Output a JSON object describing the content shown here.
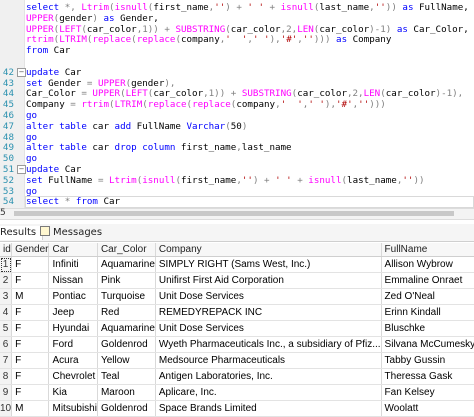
{
  "editor": {
    "lines": [
      {
        "n": "",
        "tokens": [
          [
            "kw",
            "select "
          ],
          [
            "op",
            "*, "
          ],
          [
            "fn",
            "Ltrim"
          ],
          [
            "op",
            "("
          ],
          [
            "fn",
            "isnull"
          ],
          [
            "op",
            "("
          ],
          [
            "pl",
            "first_name"
          ],
          [
            "op",
            ","
          ],
          [
            "str",
            "''"
          ],
          [
            "op",
            ") + "
          ],
          [
            "str",
            "' '"
          ],
          [
            "op",
            " + "
          ],
          [
            "fn",
            "isnull"
          ],
          [
            "op",
            "("
          ],
          [
            "pl",
            "last_name"
          ],
          [
            "op",
            ","
          ],
          [
            "str",
            "''"
          ],
          [
            "op",
            "))"
          ],
          [
            "kw",
            " as "
          ],
          [
            "pl",
            "FullName,"
          ]
        ]
      },
      {
        "n": "",
        "tokens": [
          [
            "fn",
            "UPPER"
          ],
          [
            "op",
            "("
          ],
          [
            "pl",
            "gender"
          ],
          [
            "op",
            ")"
          ],
          [
            "kw",
            " as "
          ],
          [
            "pl",
            "Gender,"
          ]
        ]
      },
      {
        "n": "",
        "tokens": [
          [
            "fn",
            "UPPER"
          ],
          [
            "op",
            "("
          ],
          [
            "fn",
            "LEFT"
          ],
          [
            "op",
            "("
          ],
          [
            "pl",
            "car_color"
          ],
          [
            "op",
            ",1)) + "
          ],
          [
            "fn",
            "SUBSTRING"
          ],
          [
            "op",
            "("
          ],
          [
            "pl",
            "car_color"
          ],
          [
            "op",
            ",2,"
          ],
          [
            "fn",
            "LEN"
          ],
          [
            "op",
            "("
          ],
          [
            "pl",
            "car_color"
          ],
          [
            "op",
            ")-1)"
          ],
          [
            "kw",
            " as "
          ],
          [
            "pl",
            "Car_Color,"
          ]
        ]
      },
      {
        "n": "",
        "tokens": [
          [
            "fn",
            "rtrim"
          ],
          [
            "op",
            "("
          ],
          [
            "fn",
            "LTRIM"
          ],
          [
            "op",
            "("
          ],
          [
            "fn",
            "replace"
          ],
          [
            "op",
            "("
          ],
          [
            "fn",
            "replace"
          ],
          [
            "op",
            "("
          ],
          [
            "pl",
            "company"
          ],
          [
            "op",
            ","
          ],
          [
            "str",
            "'  '"
          ],
          [
            "op",
            ","
          ],
          [
            "str",
            "' '"
          ],
          [
            "op",
            "),"
          ],
          [
            "str",
            "'#'"
          ],
          [
            "op",
            ","
          ],
          [
            "str",
            "''"
          ],
          [
            "op",
            ")))"
          ],
          [
            "kw",
            " as "
          ],
          [
            "pl",
            "Company"
          ]
        ]
      },
      {
        "n": "",
        "tokens": [
          [
            "kw",
            "from "
          ],
          [
            "pl",
            "Car"
          ]
        ]
      },
      {
        "n": "",
        "tokens": []
      },
      {
        "n": "42",
        "tokens": [
          [
            "kw",
            "update "
          ],
          [
            "pl",
            "Car"
          ]
        ]
      },
      {
        "n": "43",
        "tokens": [
          [
            "kw",
            "set "
          ],
          [
            "pl",
            "Gender "
          ],
          [
            "op",
            "= "
          ],
          [
            "fn",
            "UPPER"
          ],
          [
            "op",
            "("
          ],
          [
            "pl",
            "gender"
          ],
          [
            "op",
            "),"
          ]
        ]
      },
      {
        "n": "44",
        "tokens": [
          [
            "pl",
            "Car_Color "
          ],
          [
            "op",
            "= "
          ],
          [
            "fn",
            "UPPER"
          ],
          [
            "op",
            "("
          ],
          [
            "fn",
            "LEFT"
          ],
          [
            "op",
            "("
          ],
          [
            "pl",
            "car_color"
          ],
          [
            "op",
            ",1)) + "
          ],
          [
            "fn",
            "SUBSTRING"
          ],
          [
            "op",
            "("
          ],
          [
            "pl",
            "car_color"
          ],
          [
            "op",
            ",2,"
          ],
          [
            "fn",
            "LEN"
          ],
          [
            "op",
            "("
          ],
          [
            "pl",
            "car_color"
          ],
          [
            "op",
            ")-1),"
          ]
        ]
      },
      {
        "n": "45",
        "tokens": [
          [
            "pl",
            "Company "
          ],
          [
            "op",
            "= "
          ],
          [
            "fn",
            "rtrim"
          ],
          [
            "op",
            "("
          ],
          [
            "fn",
            "LTRIM"
          ],
          [
            "op",
            "("
          ],
          [
            "fn",
            "replace"
          ],
          [
            "op",
            "("
          ],
          [
            "fn",
            "replace"
          ],
          [
            "op",
            "("
          ],
          [
            "pl",
            "company"
          ],
          [
            "op",
            ","
          ],
          [
            "str",
            "'  '"
          ],
          [
            "op",
            ","
          ],
          [
            "str",
            "' '"
          ],
          [
            "op",
            "),"
          ],
          [
            "str",
            "'#'"
          ],
          [
            "op",
            ","
          ],
          [
            "str",
            "''"
          ],
          [
            "op",
            ")))"
          ]
        ]
      },
      {
        "n": "46",
        "tokens": [
          [
            "kw",
            "go"
          ]
        ]
      },
      {
        "n": "47",
        "tokens": [
          [
            "kw",
            "alter table "
          ],
          [
            "pl",
            "car "
          ],
          [
            "kw",
            "add "
          ],
          [
            "pl",
            "FullName "
          ],
          [
            "kw",
            "Varchar"
          ],
          [
            "op",
            "("
          ],
          [
            "pl",
            "50"
          ],
          [
            "op",
            ")"
          ]
        ]
      },
      {
        "n": "48",
        "tokens": [
          [
            "kw",
            "go"
          ]
        ]
      },
      {
        "n": "49",
        "tokens": [
          [
            "kw",
            "alter table "
          ],
          [
            "pl",
            "car "
          ],
          [
            "kw",
            "drop column "
          ],
          [
            "pl",
            "first_name"
          ],
          [
            "op",
            ","
          ],
          [
            "pl",
            "last_name"
          ]
        ]
      },
      {
        "n": "50",
        "tokens": [
          [
            "kw",
            "go"
          ]
        ]
      },
      {
        "n": "51",
        "tokens": [
          [
            "kw",
            "update "
          ],
          [
            "pl",
            "Car"
          ]
        ]
      },
      {
        "n": "52",
        "tokens": [
          [
            "kw",
            "set "
          ],
          [
            "pl",
            "FullName "
          ],
          [
            "op",
            "= "
          ],
          [
            "fn",
            "Ltrim"
          ],
          [
            "op",
            "("
          ],
          [
            "fn",
            "isnull"
          ],
          [
            "op",
            "("
          ],
          [
            "pl",
            "first_name"
          ],
          [
            "op",
            ","
          ],
          [
            "str",
            "''"
          ],
          [
            "op",
            ") + "
          ],
          [
            "str",
            "' '"
          ],
          [
            "op",
            " + "
          ],
          [
            "fn",
            "isnull"
          ],
          [
            "op",
            "("
          ],
          [
            "pl",
            "last_name"
          ],
          [
            "op",
            ","
          ],
          [
            "str",
            "''"
          ],
          [
            "op",
            "))"
          ]
        ]
      },
      {
        "n": "53",
        "tokens": [
          [
            "kw",
            "go"
          ]
        ]
      },
      {
        "n": "54",
        "tokens": [
          [
            "kw",
            "select "
          ],
          [
            "op",
            "* "
          ],
          [
            "kw",
            "from "
          ],
          [
            "pl",
            "Car"
          ]
        ]
      }
    ]
  },
  "scroll": {
    "zoom_label": "5"
  },
  "tabs": {
    "results": "Results",
    "messages": "Messages"
  },
  "grid": {
    "headers": [
      "id",
      "Gender",
      "Car",
      "Car_Color",
      "Company",
      "FullName"
    ],
    "rows": [
      [
        "1",
        "F",
        "Infiniti",
        "Aquamarine",
        "SIMPLY RIGHT (Sams West, Inc.)",
        "Allison Wybrow"
      ],
      [
        "2",
        "F",
        "Nissan",
        "Pink",
        "Unifirst First Aid Corporation",
        "Emmaline Onraet"
      ],
      [
        "3",
        "M",
        "Pontiac",
        "Turquoise",
        "Unit Dose Services",
        "Zed O'Neal"
      ],
      [
        "4",
        "F",
        "Jeep",
        "Red",
        "REMEDYREPACK INC",
        "Erinn Kindall"
      ],
      [
        "5",
        "F",
        "Hyundai",
        "Aquamarine",
        "Unit Dose Services",
        "Bluschke"
      ],
      [
        "6",
        "F",
        "Ford",
        "Goldenrod",
        "Wyeth Pharmaceuticals Inc., a subsidiary of Pfiz...",
        "Silvana McCumesky"
      ],
      [
        "7",
        "F",
        "Acura",
        "Yellow",
        "Medsource Pharmaceuticals",
        "Tabby Gussin"
      ],
      [
        "8",
        "F",
        "Chevrolet",
        "Teal",
        "Antigen Laboratories, Inc.",
        "Theressa Gask"
      ],
      [
        "9",
        "F",
        "Kia",
        "Maroon",
        "Aplicare, Inc.",
        "Fan Kelsey"
      ],
      [
        "10",
        "M",
        "Mitsubishi",
        "Goldenrod",
        "Space Brands Limited",
        "Woolatt"
      ]
    ]
  }
}
